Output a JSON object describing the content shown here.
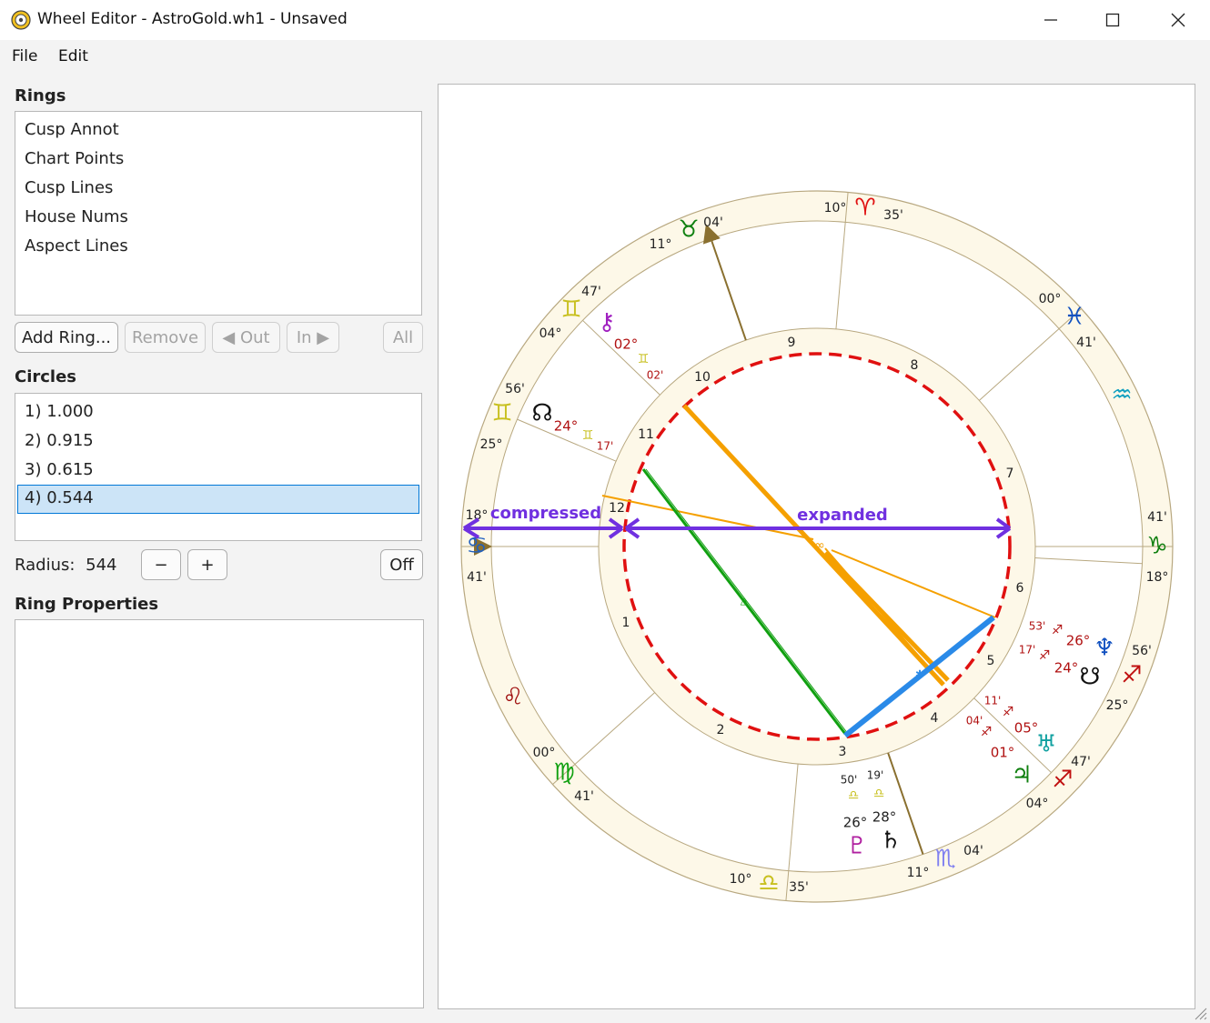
{
  "window": {
    "title": "Wheel Editor - AstroGold.wh1 - Unsaved",
    "icon": "app-wheel-icon",
    "minimize_icon": "minimize-icon",
    "maximize_icon": "maximize-icon",
    "close_icon": "close-icon"
  },
  "menu": {
    "file": "File",
    "edit": "Edit"
  },
  "rings": {
    "heading": "Rings",
    "items": [
      "Cusp Annot",
      "Chart Points",
      "Cusp Lines",
      "House Nums",
      "Aspect Lines"
    ],
    "buttons": {
      "add": "Add Ring...",
      "remove": "Remove",
      "out": "◀ Out",
      "in": "In ▶",
      "all": "All"
    }
  },
  "circles": {
    "heading": "Circles",
    "items": [
      "1) 1.000",
      "2) 0.915",
      "3) 0.615",
      "4) 0.544"
    ],
    "selected_index": 3
  },
  "radius": {
    "label": "Radius:",
    "value": "544",
    "minus": "−",
    "plus": "+",
    "off": "Off"
  },
  "ring_properties": {
    "heading": "Ring Properties"
  },
  "chart": {
    "annotations": {
      "left": "compressed",
      "right": "expanded"
    },
    "colors": {
      "ring_fill": "#fdf8e8",
      "ring_stroke": "#b8a880",
      "dashed_circle": "#e01010",
      "arrow": "#7030e0",
      "aspect_orange": "#f5a000",
      "aspect_green": "#10a010",
      "aspect_blue": "#2a8ae8",
      "arrow_line": "#8a7030",
      "degree_red": "#b01010"
    },
    "house_numbers": [
      "1",
      "2",
      "3",
      "4",
      "5",
      "6",
      "7",
      "8",
      "9",
      "10",
      "11",
      "12"
    ],
    "sign_labels": [
      {
        "glyph": "♈",
        "deg": "10°",
        "min": "35'"
      },
      {
        "glyph": "♉",
        "deg": "11°",
        "min": "04'"
      },
      {
        "glyph": "♊",
        "deg": "04°",
        "min": "47'"
      },
      {
        "glyph": "♊",
        "deg": "25°",
        "min": "56'"
      },
      {
        "glyph": "♋",
        "deg": "18°",
        "min": "41'"
      },
      {
        "glyph": "♌",
        "deg": "",
        "min": ""
      },
      {
        "glyph": "♍",
        "deg": "00°",
        "min": "41'"
      },
      {
        "glyph": "♎",
        "deg": "10°",
        "min": "35'"
      },
      {
        "glyph": "♏",
        "deg": "11°",
        "min": "04'"
      },
      {
        "glyph": "♐",
        "deg": "04°",
        "min": "47'"
      },
      {
        "glyph": "♐",
        "deg": "25°",
        "min": "56'"
      },
      {
        "glyph": "♑",
        "deg": "18°",
        "min": "41'"
      },
      {
        "glyph": "♒",
        "deg": "",
        "min": ""
      },
      {
        "glyph": "♓",
        "deg": "00°",
        "min": "41'"
      }
    ],
    "planets": [
      {
        "glyph": "⚷",
        "deg": "02°",
        "sign": "♊",
        "min": "02'"
      },
      {
        "glyph": "☊",
        "deg": "24°",
        "sign": "♊",
        "min": "17'"
      },
      {
        "glyph": "♆",
        "deg": "26°",
        "sign": "♐",
        "min": "53'"
      },
      {
        "glyph": "☋",
        "deg": "24°",
        "sign": "♐",
        "min": "17'"
      },
      {
        "glyph": "♅",
        "deg": "05°",
        "sign": "♐",
        "min": "11'"
      },
      {
        "glyph": "♃",
        "deg": "01°",
        "sign": "♐",
        "min": "04'"
      },
      {
        "glyph": "♇",
        "deg": "26°",
        "sign": "♎",
        "min": "50'"
      },
      {
        "glyph": "♄",
        "deg": "28°",
        "sign": "♎",
        "min": "19'"
      }
    ]
  }
}
